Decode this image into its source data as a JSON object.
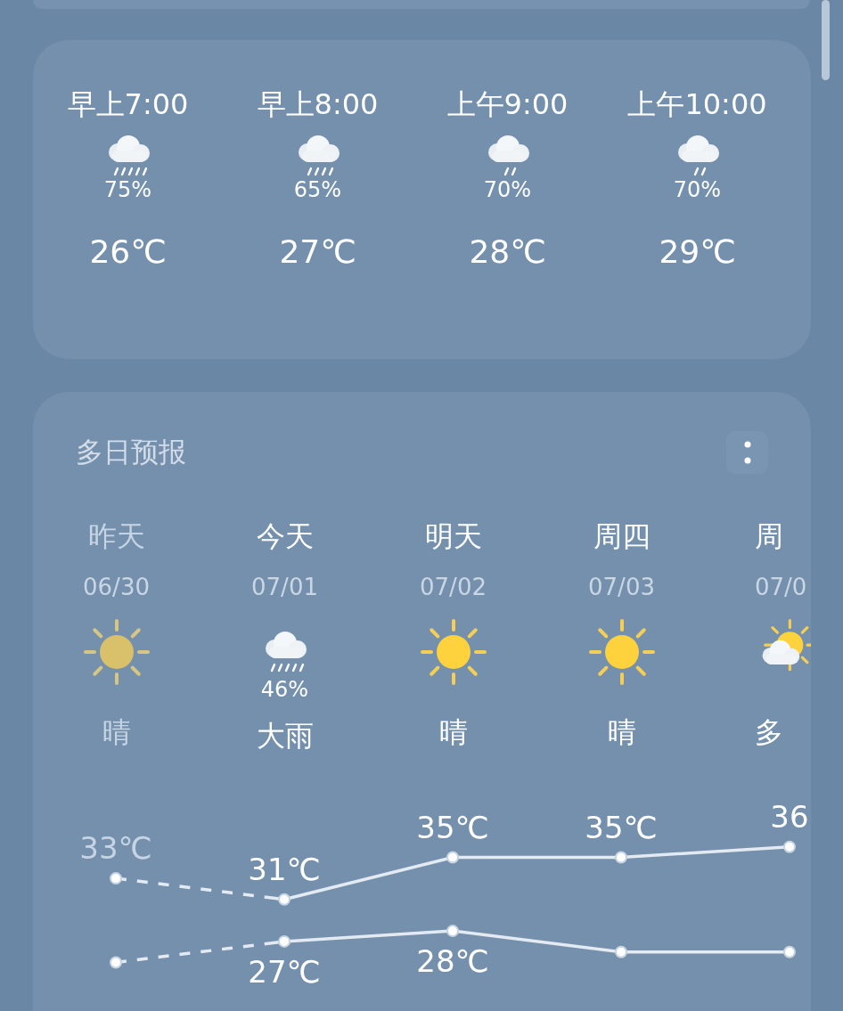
{
  "hourly": [
    {
      "time": "早上7:00",
      "kind": "rain_heavy",
      "precip": "75%",
      "temp": "26℃"
    },
    {
      "time": "早上8:00",
      "kind": "rain_moderate",
      "precip": "65%",
      "temp": "27℃"
    },
    {
      "time": "上午9:00",
      "kind": "rain_light",
      "precip": "70%",
      "temp": "28℃"
    },
    {
      "time": "上午10:00",
      "kind": "rain_light",
      "precip": "70%",
      "temp": "29℃"
    }
  ],
  "forecast": {
    "title": "多日预报",
    "days": [
      {
        "name": "昨天",
        "date": "06/30",
        "kind": "sunny",
        "condition": "晴",
        "past": true
      },
      {
        "name": "今天",
        "date": "07/01",
        "kind": "rain_heavy",
        "precip": "46%",
        "condition": "大雨",
        "past": false
      },
      {
        "name": "明天",
        "date": "07/02",
        "kind": "sunny",
        "condition": "晴",
        "past": false
      },
      {
        "name": "周四",
        "date": "07/03",
        "kind": "sunny",
        "condition": "晴",
        "past": false
      },
      {
        "name": "周",
        "date": "07/0",
        "kind": "partly_cloudy",
        "condition": "多",
        "past": false
      }
    ],
    "chart_data": {
      "type": "line",
      "categories": [
        null,
        null,
        null,
        null,
        null
      ],
      "series": [
        {
          "color": "#e3eaf2",
          "line_style": "dashed",
          "marker": "circle",
          "values": [
            33,
            31,
            35,
            35,
            36
          ],
          "value_labels": [
            "33℃",
            "31℃",
            "35℃",
            "35℃",
            "36"
          ]
        },
        {
          "color": "#e3eaf2",
          "line_style": "dashed",
          "marker": "circle",
          "values": [
            25,
            27,
            28,
            26,
            26
          ],
          "value_labels": [
            null,
            "27℃",
            "28℃",
            null,
            null
          ]
        }
      ]
    }
  }
}
